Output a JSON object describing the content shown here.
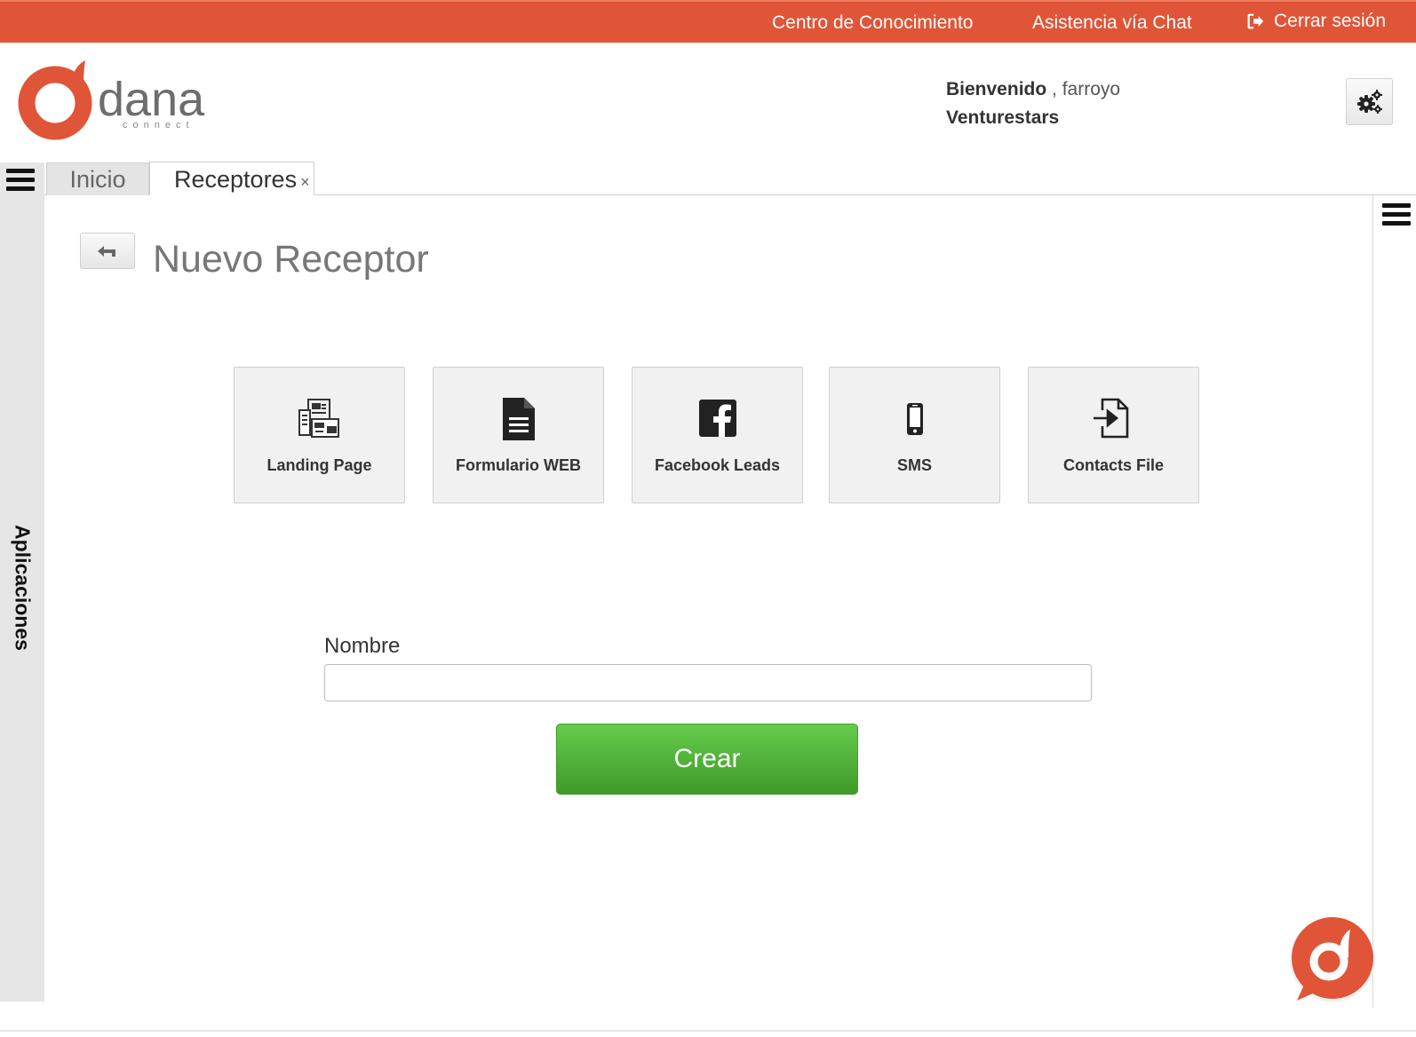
{
  "topbar": {
    "knowledge_center": "Centro de Conocimiento",
    "chat_support": "Asistencia vía Chat",
    "logout": "Cerrar sesión"
  },
  "header": {
    "logo_text": "dana",
    "logo_subtext": "connect",
    "welcome_label": "Bienvenido",
    "username": ", farroyo",
    "company": "Venturestars"
  },
  "sidebar": {
    "label": "Aplicaciones"
  },
  "tabs": [
    {
      "label": "Inicio"
    },
    {
      "label": "Receptores",
      "close": "×"
    }
  ],
  "page": {
    "title": "Nuevo Receptor"
  },
  "cards": [
    {
      "label": "Landing Page",
      "icon": "landing-page-icon"
    },
    {
      "label": "Formulario WEB",
      "icon": "document-icon"
    },
    {
      "label": "Facebook Leads",
      "icon": "facebook-icon"
    },
    {
      "label": "SMS",
      "icon": "mobile-phone-icon"
    },
    {
      "label": "Contacts File",
      "icon": "file-import-icon"
    }
  ],
  "form": {
    "name_label": "Nombre",
    "name_value": "",
    "submit_label": "Crear"
  },
  "colors": {
    "brand_orange": "#e05537",
    "button_green": "#4fb338"
  }
}
